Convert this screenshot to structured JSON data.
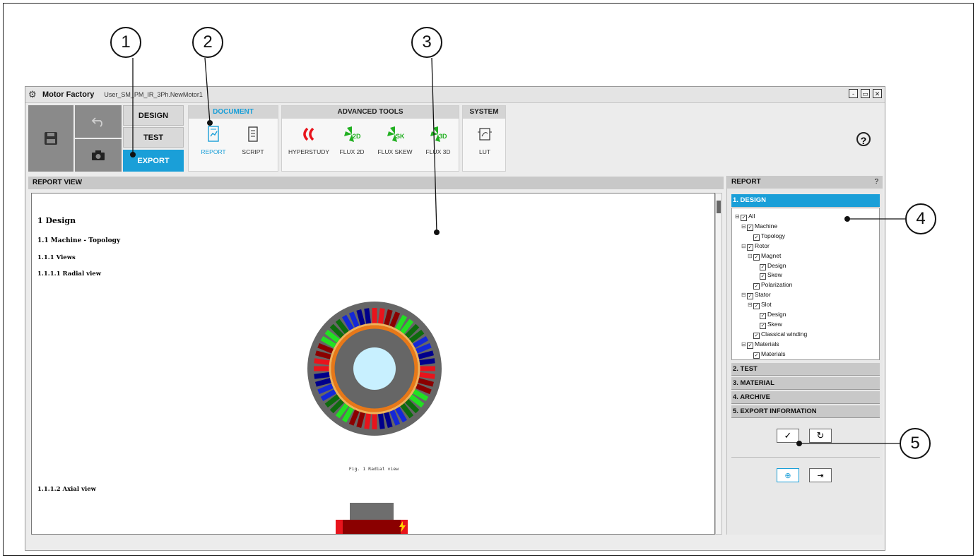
{
  "app": {
    "name": "Motor Factory",
    "file": "User_SM_PM_IR_3Ph.NewMotor1"
  },
  "window_controls": {
    "minimize": "-",
    "restore": "▭",
    "close": "✕"
  },
  "mode_tabs": {
    "design": "DESIGN",
    "test": "TEST",
    "export": "EXPORT"
  },
  "groups": {
    "document": {
      "title": "DOCUMENT",
      "tools": [
        "REPORT",
        "SCRIPT"
      ]
    },
    "advanced": {
      "title": "ADVANCED TOOLS",
      "tools": [
        "HYPERSTUDY",
        "FLUX 2D",
        "FLUX SKEW",
        "FLUX 3D"
      ]
    },
    "system": {
      "title": "SYSTEM",
      "tools": [
        "LUT"
      ]
    }
  },
  "help": "?",
  "report_view": {
    "title": "REPORT VIEW",
    "h1": "1 Design",
    "h2": "1.1 Machine - Topology",
    "h3": "1.1.1 Views",
    "h4a": "1.1.1.1 Radial view",
    "caption": "Fig. 1 Radial view",
    "h4b": "1.1.1.2 Axial view"
  },
  "report_panel": {
    "title": "REPORT",
    "help": "?",
    "sections": [
      "1. DESIGN",
      "2. TEST",
      "3. MATERIAL",
      "4. ARCHIVE",
      "5. EXPORT INFORMATION"
    ],
    "tree": [
      "All",
      "Machine",
      "Topology",
      "Rotor",
      "Magnet",
      "Design",
      "Skew",
      "Polarization",
      "Stator",
      "Slot",
      "Design",
      "Skew",
      "Classical winding",
      "Materials",
      "Materials"
    ]
  },
  "callouts": [
    "1",
    "2",
    "3",
    "4",
    "5"
  ],
  "colors": {
    "accent": "#1a9fd8",
    "dark_gray": "#8a8a8a",
    "phase_red": "#e8141c",
    "phase_green": "#22e022",
    "phase_blue": "#1428d8"
  }
}
